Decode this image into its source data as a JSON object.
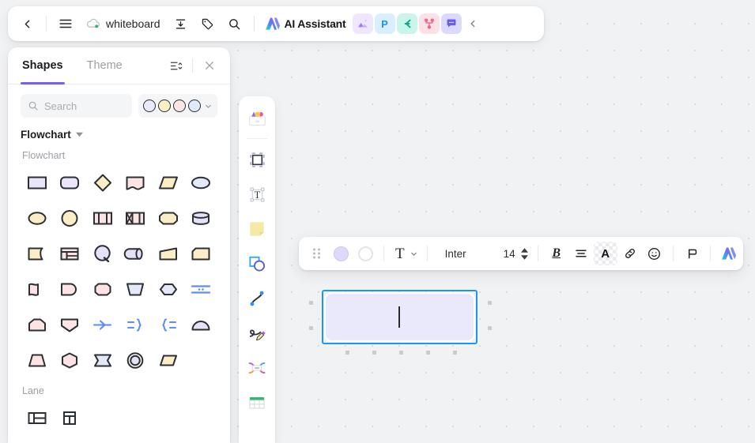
{
  "topbar": {
    "back_label": "‹",
    "menu_label": "menu",
    "doc_title": "whiteboard",
    "cloud_status": "synced",
    "export_label": "export",
    "tag_label": "tag",
    "search_label": "search",
    "ai_assistant_label": "AI Assistant",
    "collapse_label": "‹",
    "apps": [
      {
        "name": "image-app",
        "glyph": "⛰",
        "bg": "#efe6ff",
        "fg": "#8b6bf0"
      },
      {
        "name": "presentation-app",
        "glyph": "P",
        "bg": "#d9efff",
        "fg": "#2c8fe0"
      },
      {
        "name": "mindmap-app",
        "glyph": "⊂",
        "bg": "#c9f5ea",
        "fg": "#16a085"
      },
      {
        "name": "flowchart-app",
        "glyph": "⑂",
        "bg": "#ffdfe8",
        "fg": "#ef5f84"
      },
      {
        "name": "comment-app",
        "glyph": "■",
        "bg": "#dcd9ff",
        "fg": "#6a5af0"
      }
    ]
  },
  "panel": {
    "tabs": [
      {
        "label": "Shapes",
        "active": true
      },
      {
        "label": "Theme",
        "active": false
      }
    ],
    "sort_label": "sort",
    "close_label": "close",
    "search": {
      "value": "",
      "placeholder": "Search"
    },
    "palette": {
      "swatches": [
        "#ece8fb",
        "#fcefc7",
        "#fde6e6",
        "#e3e9fc"
      ],
      "chevron": "˅"
    },
    "category": {
      "name": "Flowchart",
      "chevron": "▾"
    },
    "groups": [
      {
        "label": "Flowchart",
        "shapes": [
          {
            "name": "rectangle",
            "fill": "#e9e4f8"
          },
          {
            "name": "rounded-rectangle",
            "fill": "#eae5f9"
          },
          {
            "name": "diamond",
            "fill": "#fbeec6"
          },
          {
            "name": "document",
            "fill": "#fde3e3"
          },
          {
            "name": "parallelogram",
            "fill": "#fbeec6"
          },
          {
            "name": "ellipse",
            "fill": "#e4e9fa"
          },
          {
            "name": "oval",
            "fill": "#fbeec6"
          },
          {
            "name": "circle",
            "fill": "#fbeec6"
          },
          {
            "name": "predefined-process",
            "fill": "#fde3e3"
          },
          {
            "name": "internal-storage",
            "fill": "#fde3e3"
          },
          {
            "name": "rounded-box",
            "fill": "#fbeec6"
          },
          {
            "name": "database",
            "fill": "#e4e2f6"
          },
          {
            "name": "tape-data",
            "fill": "#fbeec6"
          },
          {
            "name": "table-card",
            "fill": "#fde3e3"
          },
          {
            "name": "circle-connector",
            "fill": "#e4e2f6"
          },
          {
            "name": "cylinder-side",
            "fill": "#e4e2f6"
          },
          {
            "name": "trapezoid-right",
            "fill": "#fbeec6"
          },
          {
            "name": "note-corner",
            "fill": "#fbeec6"
          },
          {
            "name": "wave-flag",
            "fill": "#fde3e3"
          },
          {
            "name": "terminator-half",
            "fill": "#fde3e3"
          },
          {
            "name": "hexagon-round",
            "fill": "#fde3e3"
          },
          {
            "name": "manual-operation",
            "fill": "#e4e9fa"
          },
          {
            "name": "hexagon",
            "fill": "#e4e9fa"
          },
          {
            "name": "divider-lines",
            "fill": "#5b8df6"
          },
          {
            "name": "pentagon-home",
            "fill": "#fde3e3"
          },
          {
            "name": "shield",
            "fill": "#fde3e3"
          },
          {
            "name": "arrow-connector",
            "fill": "#5b8df6"
          },
          {
            "name": "brace-right",
            "fill": "#5b8df6"
          },
          {
            "name": "brace-left",
            "fill": "#5b8df6"
          },
          {
            "name": "semicircle",
            "fill": "#e4e2f6"
          },
          {
            "name": "trapezoid",
            "fill": "#fde3e3"
          },
          {
            "name": "hexagon-flat",
            "fill": "#fde3e3"
          },
          {
            "name": "sigma-flag",
            "fill": "#e4e9fa"
          },
          {
            "name": "concentric-circle",
            "fill": "#e4e2f6"
          },
          {
            "name": "rhomboid",
            "fill": "#fbeec6"
          }
        ]
      },
      {
        "label": "Lane",
        "shapes": [
          {
            "name": "lane-horizontal",
            "fill": "#ffffff"
          },
          {
            "name": "lane-vertical",
            "fill": "#ffffff"
          }
        ]
      }
    ]
  },
  "rail": {
    "items": [
      {
        "name": "template-gallery",
        "label": "Templates"
      },
      {
        "name": "frame-tool",
        "label": "Frame"
      },
      {
        "name": "text-tool",
        "label": "Text"
      },
      {
        "name": "sticky-note-tool",
        "label": "Sticky note"
      },
      {
        "name": "shape-tool",
        "label": "Shape"
      },
      {
        "name": "connector-tool",
        "label": "Connector"
      },
      {
        "name": "pen-tool",
        "label": "Pen"
      },
      {
        "name": "mindmap-tool",
        "label": "Mind map"
      },
      {
        "name": "table-tool",
        "label": "Table"
      }
    ]
  },
  "format_toolbar": {
    "drag_label": "drag",
    "fill_color": "#e0daf8",
    "fill_label": "Fill color",
    "border_label": "Border color",
    "text_style_label": "T",
    "text_style_chevron": "˅",
    "font_family": "Inter",
    "font_size": "14",
    "stepper_up": "▴",
    "stepper_down": "▾",
    "bold_label": "B",
    "align_label": "Align",
    "text_color_label": "A",
    "link_label": "Link",
    "emoji_label": "Emoji",
    "comment_label": "Comment",
    "ai_label": "AI"
  },
  "canvas": {
    "selected_shape": {
      "name": "rounded-rectangle",
      "fill": "#eae8fb",
      "selection_color": "#1f95f5",
      "text": ""
    },
    "grid": "dot",
    "background": "#f1f2f4"
  }
}
